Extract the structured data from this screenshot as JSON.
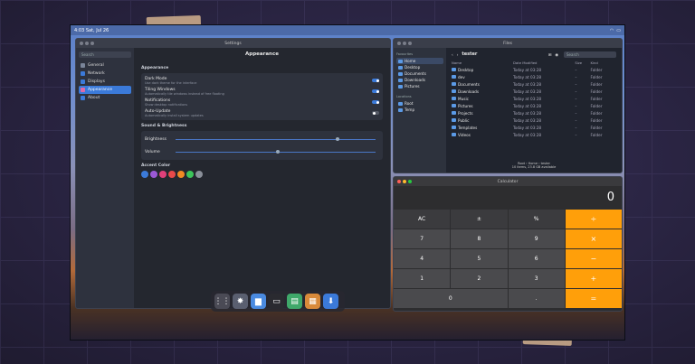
{
  "topbar": {
    "time_date": "4:03  Sat, Jul 26"
  },
  "settings": {
    "window_title": "Settings",
    "search_placeholder": "Search",
    "nav": [
      {
        "label": "General",
        "icon": "gear-icon",
        "color": "#7a8599"
      },
      {
        "label": "Network",
        "icon": "network-icon",
        "color": "#3b7ad9"
      },
      {
        "label": "Displays",
        "icon": "display-icon",
        "color": "#3b7ad9"
      },
      {
        "label": "Appearance",
        "icon": "palette-icon",
        "color": "#e06aa8"
      },
      {
        "label": "About",
        "icon": "info-icon",
        "color": "#3b7ad9"
      }
    ],
    "page_title": "Appearance",
    "section_appearance": "Appearance",
    "toggles": [
      {
        "title": "Dark Mode",
        "desc": "Use dark theme for the interface",
        "on": true
      },
      {
        "title": "Tiling Windows",
        "desc": "Automatically tile windows instead of free floating",
        "on": true
      },
      {
        "title": "Notifications",
        "desc": "Show desktop notifications",
        "on": true
      },
      {
        "title": "Auto-Update",
        "desc": "Automatically install system updates",
        "on": false
      }
    ],
    "section_sound": "Sound & Brightness",
    "brightness_label": "Brightness",
    "brightness_level": 0.8,
    "volume_label": "Volume",
    "volume_level": 0.5,
    "section_accent": "Accent Color",
    "accent_colors": [
      "#3b7ad9",
      "#9b59d6",
      "#e0407a",
      "#e84a4a",
      "#f08a24",
      "#3cc45a",
      "#8a8f99"
    ]
  },
  "files": {
    "window_title": "Files",
    "favorites_heading": "Favourites",
    "favorites": [
      "Home",
      "Desktop",
      "Documents",
      "Downloads",
      "Pictures"
    ],
    "locations_heading": "Locations",
    "locations": [
      "Root",
      "Temp"
    ],
    "path": "tester",
    "search_placeholder": "Search",
    "columns": [
      "Name",
      "Date Modified",
      "Size",
      "Kind"
    ],
    "rows": [
      {
        "name": "Desktop",
        "date": "Today at 03:28",
        "size": "–",
        "kind": "Folder"
      },
      {
        "name": "dev",
        "date": "Today at 03:28",
        "size": "–",
        "kind": "Folder"
      },
      {
        "name": "Documents",
        "date": "Today at 03:28",
        "size": "–",
        "kind": "Folder"
      },
      {
        "name": "Downloads",
        "date": "Today at 03:28",
        "size": "–",
        "kind": "Folder"
      },
      {
        "name": "Music",
        "date": "Today at 03:28",
        "size": "–",
        "kind": "Folder"
      },
      {
        "name": "Pictures",
        "date": "Today at 03:28",
        "size": "–",
        "kind": "Folder"
      },
      {
        "name": "Projects",
        "date": "Today at 03:28",
        "size": "–",
        "kind": "Folder"
      },
      {
        "name": "Public",
        "date": "Today at 03:28",
        "size": "–",
        "kind": "Folder"
      },
      {
        "name": "Templates",
        "date": "Today at 03:28",
        "size": "–",
        "kind": "Folder"
      },
      {
        "name": "Videos",
        "date": "Today at 03:28",
        "size": "–",
        "kind": "Folder"
      }
    ],
    "breadcrumb": "Root  ›  Home  ›  tester",
    "status": "10 items, 23.8 GB available"
  },
  "calculator": {
    "window_title": "Calculator",
    "display": "0",
    "keys": [
      {
        "label": "AC",
        "kind": "top"
      },
      {
        "label": "±",
        "kind": "top"
      },
      {
        "label": "%",
        "kind": "top"
      },
      {
        "label": "÷",
        "kind": "op"
      },
      {
        "label": "7",
        "kind": "num"
      },
      {
        "label": "8",
        "kind": "num"
      },
      {
        "label": "9",
        "kind": "num"
      },
      {
        "label": "×",
        "kind": "op"
      },
      {
        "label": "4",
        "kind": "num"
      },
      {
        "label": "5",
        "kind": "num"
      },
      {
        "label": "6",
        "kind": "num"
      },
      {
        "label": "−",
        "kind": "op"
      },
      {
        "label": "1",
        "kind": "num"
      },
      {
        "label": "2",
        "kind": "num"
      },
      {
        "label": "3",
        "kind": "num"
      },
      {
        "label": "+",
        "kind": "op"
      },
      {
        "label": "0",
        "kind": "zero"
      },
      {
        "label": ".",
        "kind": "num"
      },
      {
        "label": "=",
        "kind": "op"
      }
    ]
  },
  "dock": [
    {
      "icon": "app-grid-icon",
      "glyph": "⋮⋮",
      "color": "#4a4a55"
    },
    {
      "icon": "settings-icon",
      "glyph": "✸",
      "color": "#5a5f70"
    },
    {
      "icon": "files-icon",
      "glyph": "▆",
      "color": "#4a8ae0"
    },
    {
      "icon": "terminal-icon",
      "glyph": "▭",
      "color": "#2a2a30"
    },
    {
      "icon": "notes-icon",
      "glyph": "▤",
      "color": "#3fa86a"
    },
    {
      "icon": "calculator-icon",
      "glyph": "▦",
      "color": "#d98a3a"
    },
    {
      "icon": "download-icon",
      "glyph": "⬇",
      "color": "#3b7ad9"
    }
  ]
}
